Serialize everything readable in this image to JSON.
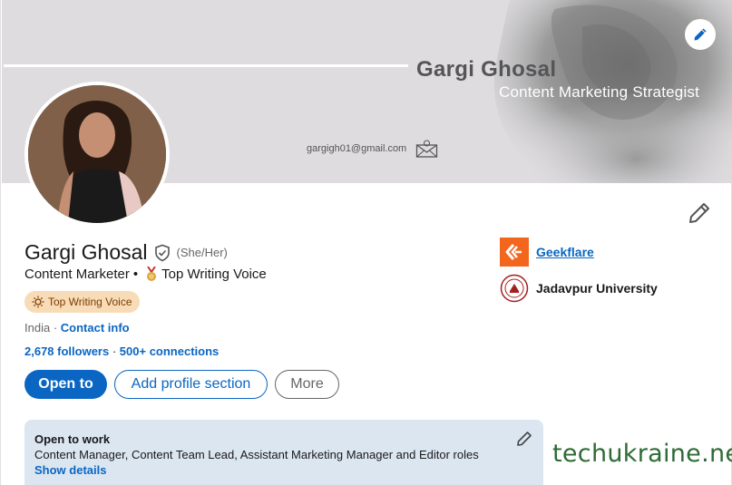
{
  "banner": {
    "name": "Gargi Ghosal",
    "role": "Content Marketing Strategist",
    "email": "gargigh01@gmail.com"
  },
  "profile": {
    "name": "Gargi Ghosal",
    "pronouns": "(She/Her)",
    "headline": "Content Marketer",
    "headline_badge": "Top Writing Voice",
    "badge_label": "Top Writing Voice",
    "location": "India",
    "contact_link": "Contact info",
    "followers": "2,678 followers",
    "connections": "500+ connections"
  },
  "actions": {
    "open_to": "Open to",
    "add_section": "Add profile section",
    "more": "More"
  },
  "experience": {
    "company": "Geekflare",
    "school": "Jadavpur University"
  },
  "open_to_work": {
    "title": "Open to work",
    "roles": "Content Manager, Content Team Lead, Assistant Marketing Manager and Editor roles",
    "link": "Show details"
  },
  "watermark": "techukraine.net",
  "colors": {
    "primary": "#0a66c2",
    "banner_bg": "#dedcdf",
    "badge_bg": "#f8dbb7",
    "otw_bg": "#dce6f1",
    "company_logo": "#f2661d"
  },
  "icons": [
    "pencil-icon",
    "mail-icon",
    "verified-shield-icon",
    "medal-icon",
    "sun-badge-icon",
    "geekflare-logo",
    "university-seal"
  ]
}
